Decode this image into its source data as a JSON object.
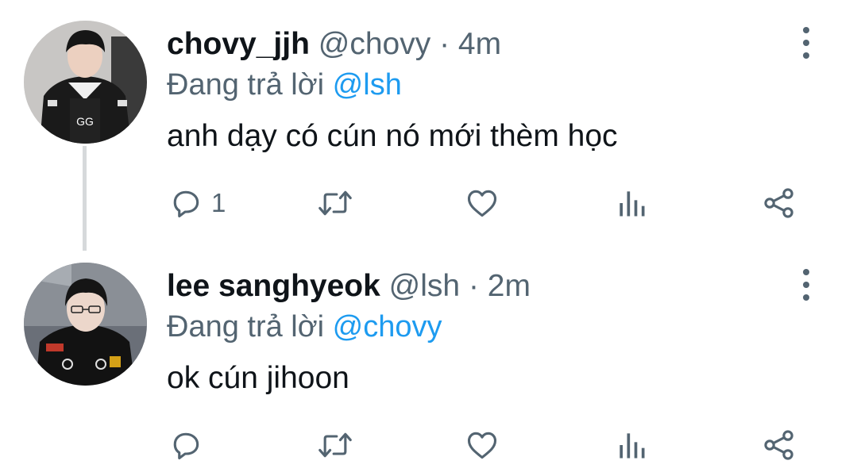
{
  "tweets": [
    {
      "display_name": "chovy_jjh",
      "handle": "@chovy",
      "separator": "·",
      "time": "4m",
      "reply_prefix": "Đang trả lời",
      "reply_to": "@lsh",
      "text": "anh dạy có cún nó mới thèm học",
      "reply_count": "1",
      "avatar": "avatar-chovy"
    },
    {
      "display_name": "lee sanghyeok",
      "handle": "@lsh",
      "separator": "·",
      "time": "2m",
      "reply_prefix": "Đang trả lời",
      "reply_to": "@chovy",
      "text": "ok cún jihoon",
      "reply_count": "",
      "avatar": "avatar-lsh"
    }
  ],
  "icons": {
    "reply": "reply-icon",
    "retweet": "retweet-icon",
    "like": "like-icon",
    "stats": "stats-icon",
    "share": "share-icon",
    "more": "more-options-icon"
  },
  "colors": {
    "mention": "#1d9bf0",
    "secondary_text": "#536471",
    "primary_text": "#0f1419",
    "thread_line": "#d6d9db"
  }
}
